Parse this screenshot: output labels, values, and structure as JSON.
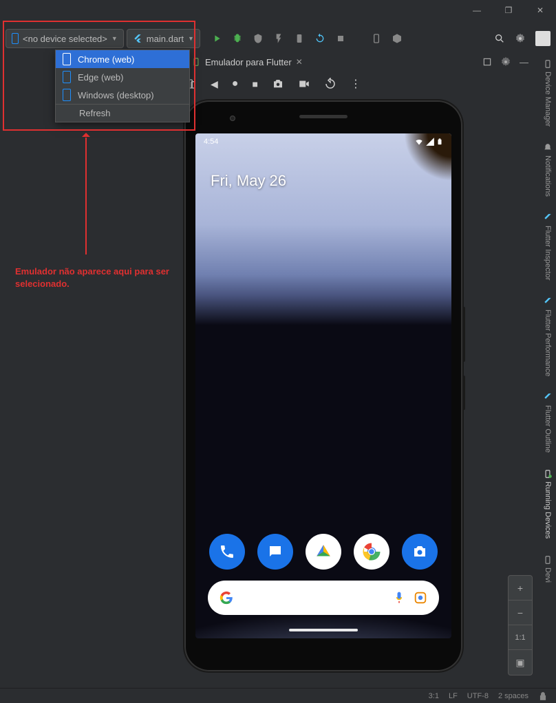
{
  "window": {
    "minimize": "—",
    "maximize": "❐",
    "close": "✕"
  },
  "toolbar": {
    "device_selector": "<no device selected>",
    "run_config": "main.dart"
  },
  "dropdown": {
    "items": [
      {
        "label": "Chrome (web)",
        "selected": true
      },
      {
        "label": "Edge (web)",
        "selected": false
      },
      {
        "label": "Windows (desktop)",
        "selected": false
      }
    ],
    "refresh": "Refresh"
  },
  "tabs": {
    "emulator": "Emulador para Flutter"
  },
  "annotation": {
    "text": "Emulador não aparece aqui para ser selecionado."
  },
  "phone": {
    "time": "4:54",
    "date": "Fri, May 26"
  },
  "side_panels": {
    "device_manager": "Device Manager",
    "notifications": "Notifications",
    "flutter_inspector": "Flutter Inspector",
    "flutter_performance": "Flutter Performance",
    "flutter_outline": "Flutter Outline",
    "running_devices": "Running Devices",
    "devi": "Devi"
  },
  "zoom": {
    "plus": "+",
    "minus": "−",
    "fit": "1:1",
    "box": "▣"
  },
  "statusbar": {
    "pos": "3:1",
    "sep": "LF",
    "enc": "UTF-8",
    "indent": "2 spaces"
  }
}
